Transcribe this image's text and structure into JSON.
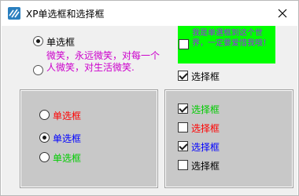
{
  "window": {
    "title": "XP单选框和选择框"
  },
  "left": {
    "radio1_label": "单选框",
    "radio2_text": "微笑，永远微笑，对每一个人微笑，对生活微笑."
  },
  "right": {
    "green_check_text": "我是单選框到这个世界，一定要爱惜我哦！",
    "check_label": "选择框"
  },
  "group_left": {
    "items": [
      {
        "label": "单选框",
        "color": "#ff0000",
        "checked": false
      },
      {
        "label": "单选框",
        "color": "#0000ff",
        "checked": true
      },
      {
        "label": "单选框",
        "color": "#00cc00",
        "checked": false
      }
    ]
  },
  "group_right": {
    "items": [
      {
        "label": "选择框",
        "color": "#00cc00",
        "checked": true
      },
      {
        "label": "选择框",
        "color": "#ff0000",
        "checked": false
      },
      {
        "label": "选择框",
        "color": "#0000ff",
        "checked": true
      },
      {
        "label": "选择框",
        "color": "#000000",
        "checked": false
      }
    ]
  },
  "colors": {
    "green_panel": "#00ff00",
    "purple_text": "#a020f0",
    "magenta_text": "#cc00cc",
    "group_bg": "#c8c8c8"
  },
  "icons": {
    "app": "app-icon",
    "close": "close-icon"
  }
}
